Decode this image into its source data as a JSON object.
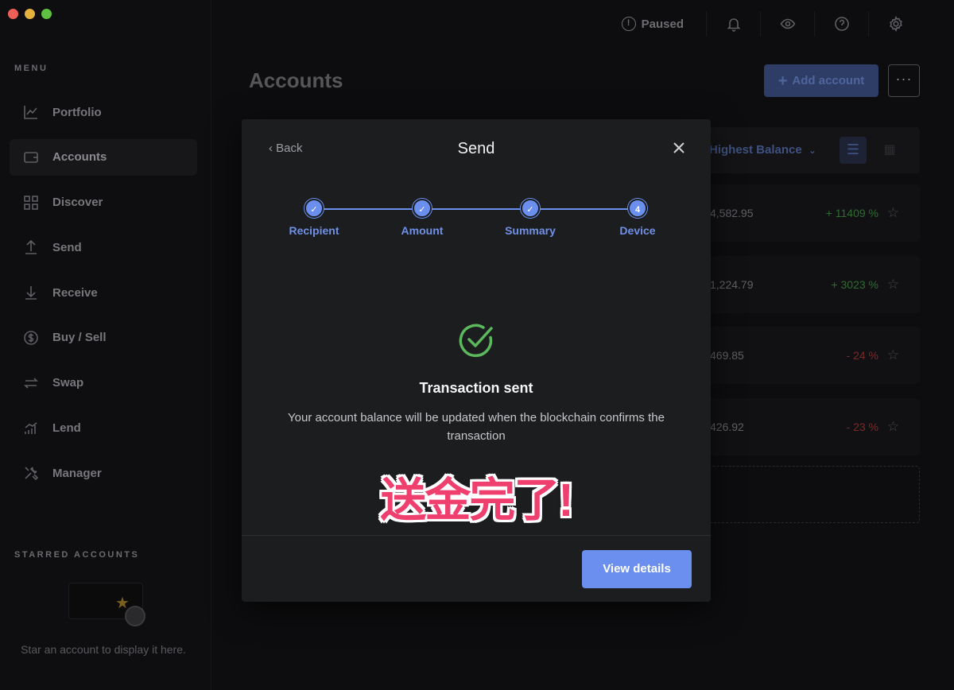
{
  "window": {
    "traffic_colors": [
      "#ed5f57",
      "#e4b23c",
      "#5ec140"
    ]
  },
  "sidebar": {
    "menu_label": "MENU",
    "items": [
      {
        "label": "Portfolio",
        "icon": "chart-line-icon"
      },
      {
        "label": "Accounts",
        "icon": "wallet-icon",
        "active": true
      },
      {
        "label": "Discover",
        "icon": "grid-icon"
      },
      {
        "label": "Send",
        "icon": "arrow-up-icon"
      },
      {
        "label": "Receive",
        "icon": "arrow-down-icon"
      },
      {
        "label": "Buy / Sell",
        "icon": "dollar-circle-icon"
      },
      {
        "label": "Swap",
        "icon": "swap-arrows-icon"
      },
      {
        "label": "Lend",
        "icon": "bar-chart-icon"
      },
      {
        "label": "Manager",
        "icon": "tools-icon"
      }
    ],
    "starred_label": "STARRED ACCOUNTS",
    "starred_hint": "Star an account to display it here."
  },
  "topbar": {
    "paused_label": "Paused"
  },
  "main": {
    "title": "Accounts",
    "add_account_label": "Add account",
    "more_label": "···",
    "sort_label": "Highest Balance",
    "rows": [
      {
        "balance": "4,582.95",
        "change": "+ 11409 %",
        "trend": "pos"
      },
      {
        "balance": "1,224.79",
        "change": "+ 3023 %",
        "trend": "pos"
      },
      {
        "balance": "469.85",
        "change": "- 24 %",
        "trend": "neg"
      },
      {
        "balance": "426.92",
        "change": "- 23 %",
        "trend": "neg"
      }
    ]
  },
  "modal": {
    "back_label": "‹ Back",
    "title": "Send",
    "steps": [
      {
        "label": "Recipient",
        "done": true,
        "mark": "✓"
      },
      {
        "label": "Amount",
        "done": true,
        "mark": "✓"
      },
      {
        "label": "Summary",
        "done": true,
        "mark": "✓"
      },
      {
        "label": "Device",
        "done": false,
        "mark": "4"
      }
    ],
    "heading": "Transaction sent",
    "message": "Your account balance will be updated when the blockchain confirms the transaction",
    "overlay_text": "送金完了!",
    "view_details_label": "View details",
    "accent_color": "#6b8fee",
    "success_color": "#5cb85c"
  }
}
